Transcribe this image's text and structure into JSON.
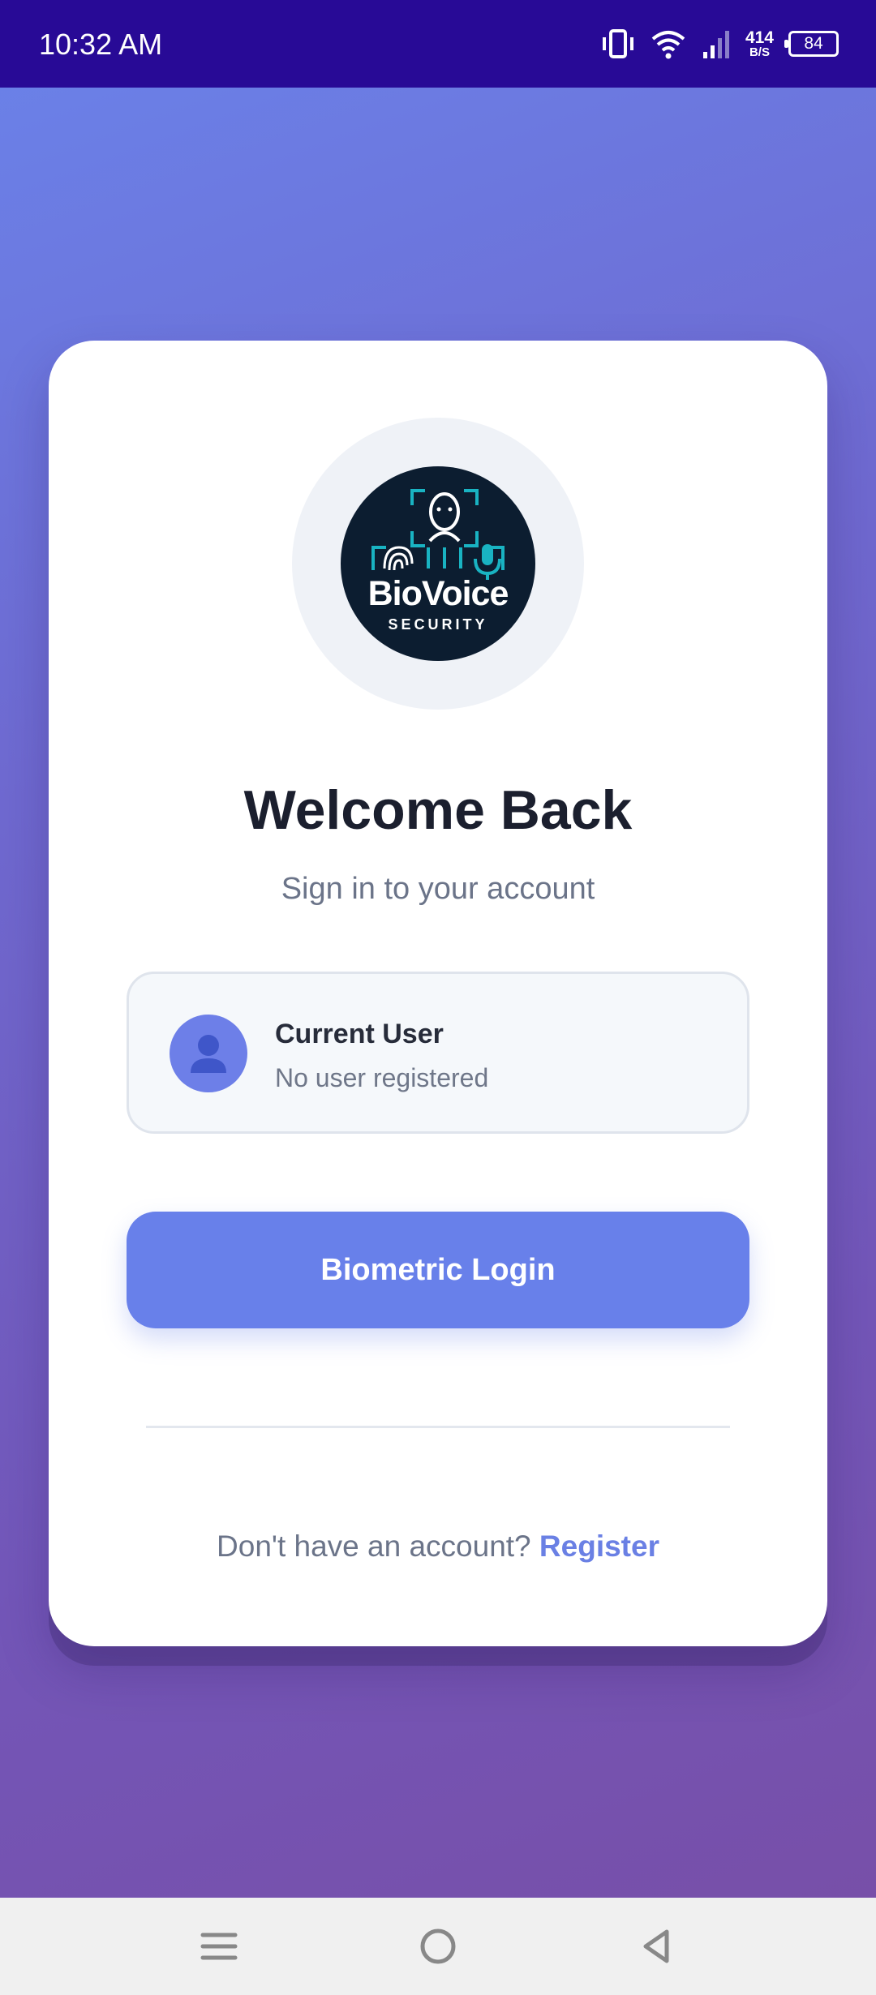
{
  "status_bar": {
    "time": "10:32 AM",
    "net_speed_value": "414",
    "net_speed_unit": "B/S",
    "battery": "84",
    "icons": [
      "vibrate-icon",
      "wifi-icon",
      "signal-icon"
    ]
  },
  "logo": {
    "name": "BioVoice",
    "subtitle": "SECURITY",
    "icons": [
      "face-icon",
      "fingerprint-icon",
      "microphone-icon"
    ]
  },
  "login": {
    "title": "Welcome Back",
    "subtitle": "Sign in to your account"
  },
  "current_user": {
    "title": "Current User",
    "status": "No user registered",
    "avatar_icon": "user-icon"
  },
  "actions": {
    "biometric_login_label": "Biometric Login",
    "register_prompt": "Don't have an account?",
    "register_link": "Register"
  },
  "nav_bar": {
    "icons": [
      "menu-icon",
      "home-icon",
      "back-icon"
    ]
  },
  "colors": {
    "status_bar": "#280a96",
    "accent": "#6880ea",
    "card": "#ffffff",
    "logo_background": "#0c1d30",
    "logo_teal": "#19b3c2"
  }
}
